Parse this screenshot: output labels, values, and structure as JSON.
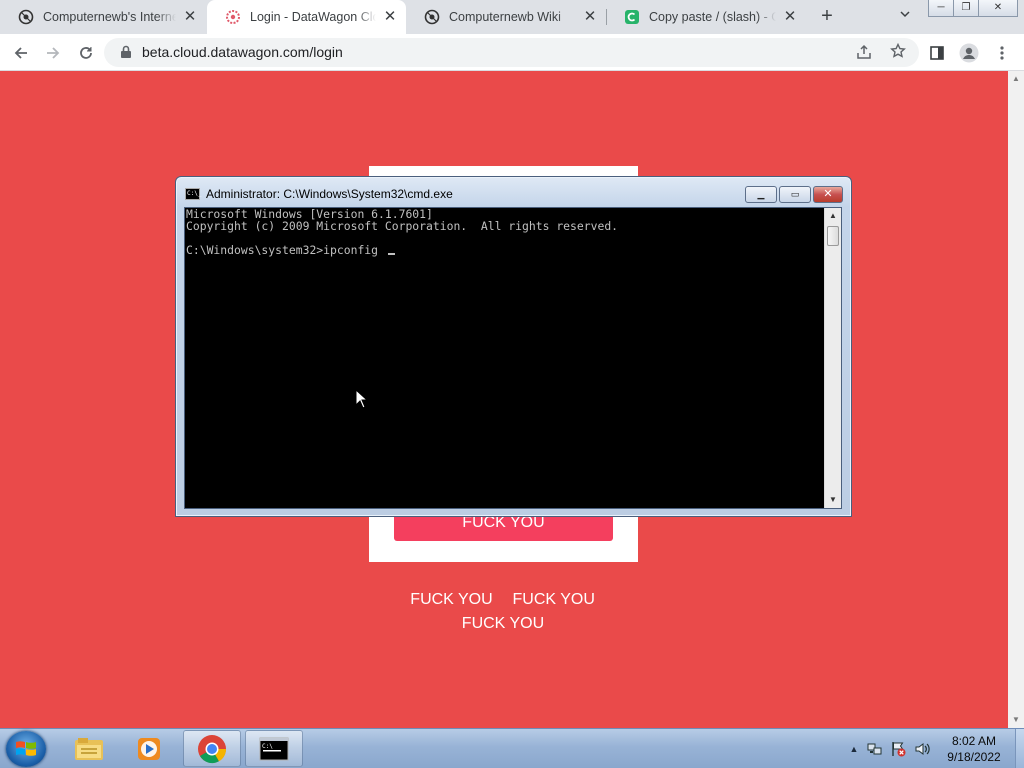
{
  "browser": {
    "tabs": [
      {
        "title": "Computernewb's Internet",
        "icon": "computernewb-icon",
        "active": false
      },
      {
        "title": "Login - DataWagon Cloud",
        "icon": "datawagon-icon",
        "active": true
      },
      {
        "title": "Computernewb Wiki",
        "icon": "computernewb-icon",
        "active": false
      },
      {
        "title": "Copy paste / (slash) - Glyph",
        "icon": "glyph-icon",
        "active": false
      }
    ],
    "url": "beta.cloud.datawagon.com/login"
  },
  "page": {
    "background_color": "#ea4a4a",
    "button_label": "FUCK YOU",
    "button_color": "#f43f5e",
    "links": [
      "FUCK YOU",
      "FUCK YOU",
      "FUCK YOU"
    ]
  },
  "cmd_window": {
    "title": "Administrator: C:\\Windows\\System32\\cmd.exe",
    "lines": [
      "Microsoft Windows [Version 6.1.7601]",
      "Copyright (c) 2009 Microsoft Corporation.  All rights reserved.",
      "",
      "C:\\Windows\\system32>ipconfig "
    ]
  },
  "taskbar": {
    "apps": [
      "windows-explorer-icon",
      "media-player-icon",
      "chrome-icon",
      "cmd-icon"
    ],
    "clock_time": "8:02 AM",
    "clock_date": "9/18/2022"
  }
}
